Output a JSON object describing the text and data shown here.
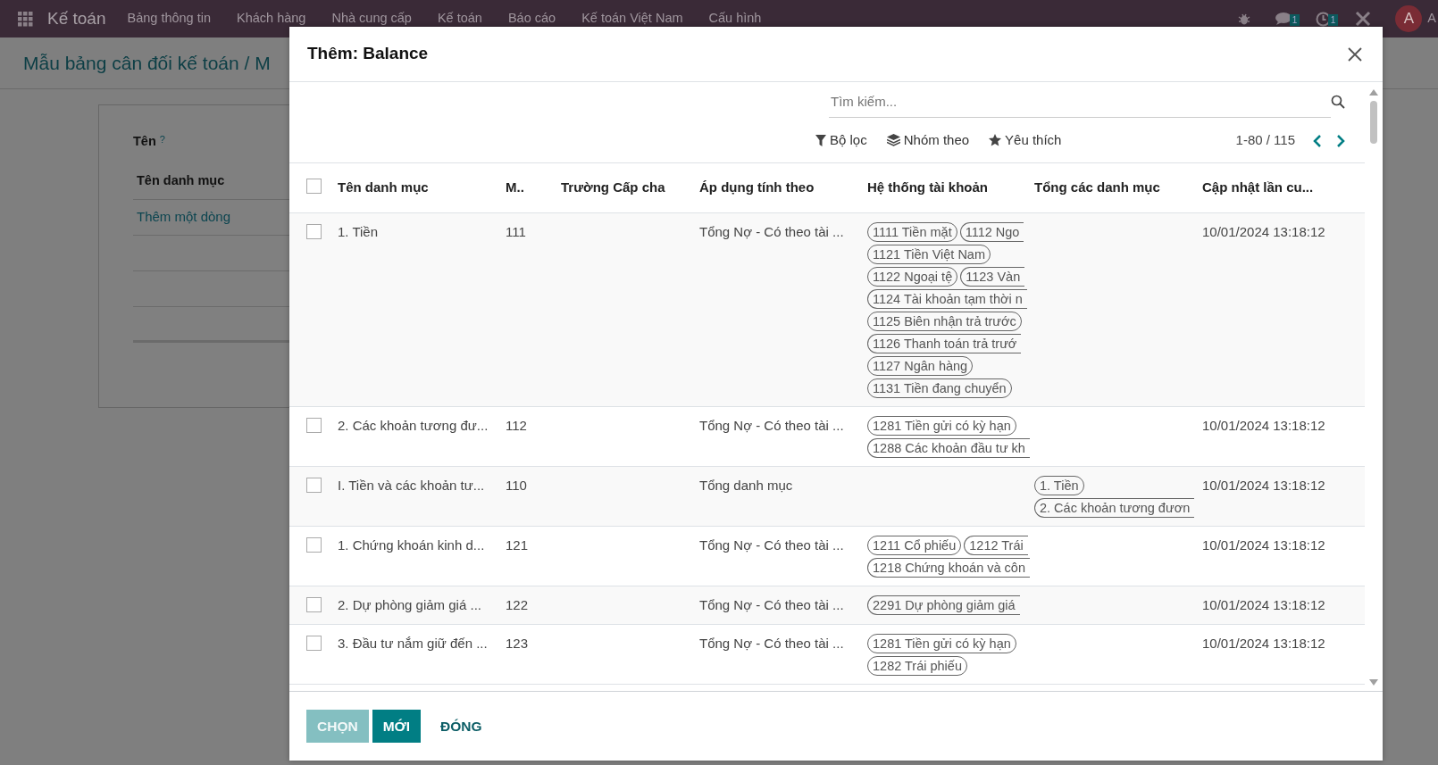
{
  "navbar": {
    "app_name": "Kế toán",
    "menu": [
      "Bảng thông tin",
      "Khách hàng",
      "Nhà cung cấp",
      "Kế toán",
      "Báo cáo",
      "Kế toán Việt Nam",
      "Cấu hình"
    ],
    "messages_badge": "1",
    "activities_badge": "1",
    "avatar": "A",
    "user_name": "A"
  },
  "breadcrumb": "Mẫu bảng cân đối kế toán / M",
  "form": {
    "field_label": "Tên",
    "help_mark": "?",
    "lines_column": "Tên danh mục",
    "add_line": "Thêm một dòng"
  },
  "dialog": {
    "title": "Thêm: Balance",
    "search": {
      "placeholder": "Tìm kiếm..."
    },
    "filters": [
      {
        "label": "Bộ lọc",
        "kind": "filter"
      },
      {
        "label": "Nhóm theo",
        "kind": "group"
      },
      {
        "label": "Yêu thích",
        "kind": "favorite"
      }
    ],
    "pager": "1-80 / 115",
    "all_selected": false,
    "columns": [
      "Tên danh mục",
      "M..",
      "Trường Cấp cha",
      "Áp dụng tính theo",
      "Hệ thống tài khoản",
      "Tổng các danh mục",
      "Cập nhật lần cu..."
    ],
    "rows": [
      {
        "selected": false,
        "name": "1. Tiền",
        "code": "111",
        "apply": "Tổng Nợ - Có theo tài ...",
        "accounts": [
          [
            {
              "label": "1111 Tiền mặt",
              "clipped": false
            },
            {
              "label": "1112 Ngo",
              "clipped": true
            }
          ],
          [
            {
              "label": "1121 Tiền Việt Nam",
              "clipped": false
            }
          ],
          [
            {
              "label": "1122 Ngoại tệ",
              "clipped": false
            },
            {
              "label": "1123 Vàn",
              "clipped": true
            }
          ],
          [
            {
              "label": "1124 Tài khoản tạm thời n",
              "clipped": true
            }
          ],
          [
            {
              "label": "1125 Biên nhận trả trước",
              "clipped": false
            }
          ],
          [
            {
              "label": "1126 Thanh toán trả trướ",
              "clipped": true
            }
          ],
          [
            {
              "label": "1127 Ngân hàng",
              "clipped": false
            }
          ],
          [
            {
              "label": "1131 Tiền đang chuyển",
              "clipped": false
            }
          ]
        ],
        "totals": [],
        "updated": "10/01/2024 13:18:12"
      },
      {
        "selected": false,
        "name": "2. Các khoản tương đư...",
        "code": "112",
        "apply": "Tổng Nợ - Có theo tài ...",
        "accounts": [
          [
            {
              "label": "1281 Tiền gửi có kỳ hạn",
              "clipped": false
            }
          ],
          [
            {
              "label": "1288 Các khoản đầu tư kh",
              "clipped": true
            }
          ]
        ],
        "totals": [],
        "updated": "10/01/2024 13:18:12"
      },
      {
        "selected": false,
        "name": "I. Tiền và các khoản tư...",
        "code": "110",
        "apply": "Tổng danh mục",
        "accounts": [],
        "totals": [
          {
            "label": "1. Tiền",
            "clipped": false
          },
          {
            "label": "2. Các khoản tương đươn",
            "clipped": true
          }
        ],
        "updated": "10/01/2024 13:18:12"
      },
      {
        "selected": false,
        "name": "1. Chứng khoán kinh d...",
        "code": "121",
        "apply": "Tổng Nợ - Có theo tài ...",
        "accounts": [
          [
            {
              "label": "1211 Cổ phiếu",
              "clipped": false
            },
            {
              "label": "1212 Trái",
              "clipped": true
            }
          ],
          [
            {
              "label": "1218 Chứng khoán và côn",
              "clipped": true
            }
          ]
        ],
        "totals": [],
        "updated": "10/01/2024 13:18:12"
      },
      {
        "selected": false,
        "name": "2. Dự phòng giảm giá ...",
        "code": "122",
        "apply": "Tổng Nợ - Có theo tài ...",
        "accounts": [
          [
            {
              "label": "2291 Dự phòng giảm giá",
              "clipped": true
            }
          ]
        ],
        "totals": [],
        "updated": "10/01/2024 13:18:12"
      },
      {
        "selected": false,
        "name": "3. Đầu tư nắm giữ đến ...",
        "code": "123",
        "apply": "Tổng Nợ - Có theo tài ...",
        "accounts": [
          [
            {
              "label": "1281 Tiền gửi có kỳ hạn",
              "clipped": false
            }
          ],
          [
            {
              "label": "1282 Trái phiếu",
              "clipped": false
            }
          ]
        ],
        "totals": [],
        "updated": "10/01/2024 13:18:12"
      }
    ],
    "buttons": [
      {
        "label": "CHỌN",
        "kind": "primary",
        "disabled": true
      },
      {
        "label": "MỚI",
        "kind": "primary",
        "disabled": false
      },
      {
        "label": "ĐÓNG",
        "kind": "link",
        "disabled": false
      }
    ]
  }
}
